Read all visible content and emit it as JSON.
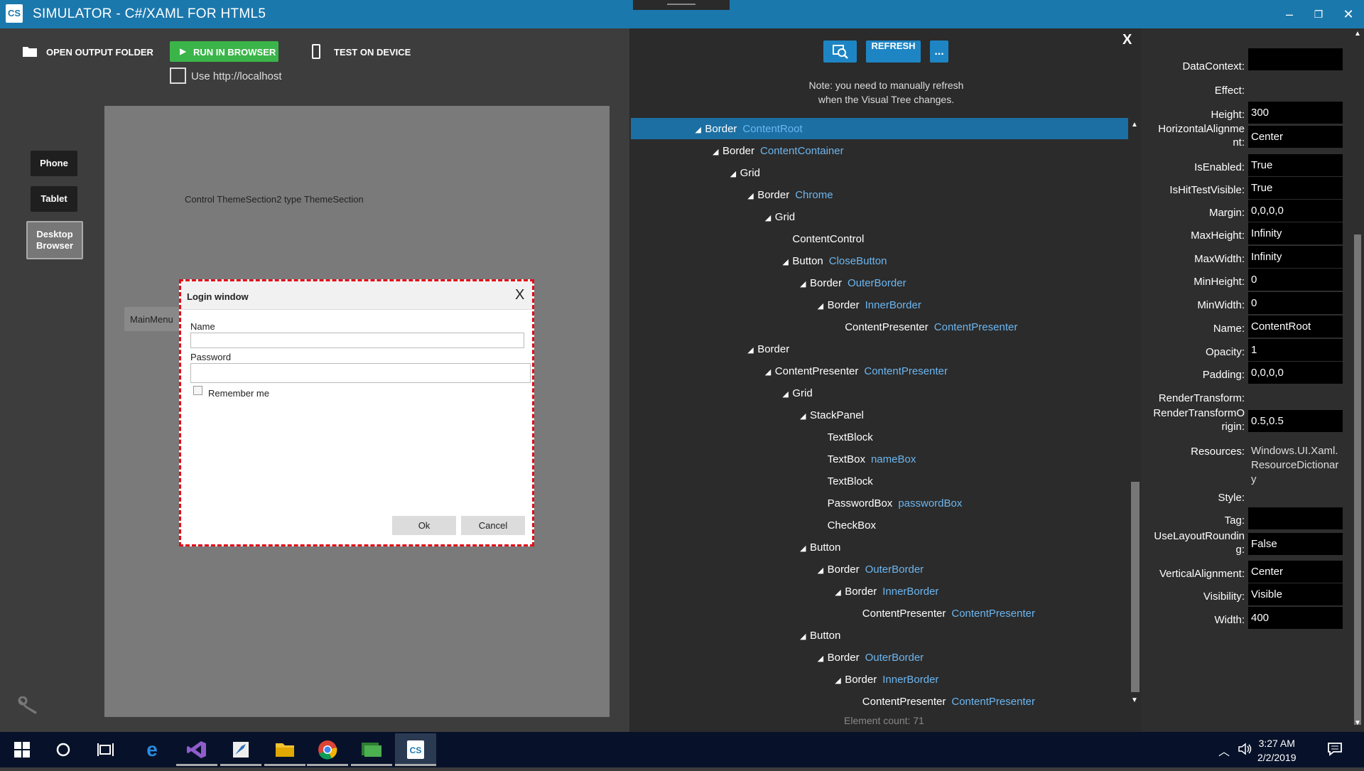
{
  "window": {
    "title": "SIMULATOR - C#/XAML FOR HTML5",
    "logo_text": "CS",
    "controls": [
      "–",
      "❐",
      "✕"
    ]
  },
  "toolbar": {
    "open_output": "OPEN OUTPUT FOLDER",
    "run_browser": "RUN IN BROWSER",
    "test_device": "TEST ON DEVICE",
    "use_localhost": "Use http://localhost"
  },
  "devices": {
    "phone": "Phone",
    "tablet": "Tablet",
    "desktop_line1": "Desktop",
    "desktop_line2": "Browser"
  },
  "preview": {
    "control_text": "Control ThemeSection2 type ThemeSection",
    "mainmenu": "MainMenu"
  },
  "login": {
    "title": "Login window",
    "close": "X",
    "name_label": "Name",
    "password_label": "Password",
    "remember": "Remember me",
    "ok": "Ok",
    "cancel": "Cancel"
  },
  "tree": {
    "refresh": "REFRESH",
    "more": "...",
    "close": "X",
    "note_line1": "Note: you need to manually refresh",
    "note_line2": "when the Visual Tree changes.",
    "element_count": "Element count: 71",
    "rows": [
      {
        "type": "Border",
        "name": "ContentRoot",
        "level": 4,
        "expanded": true,
        "selected": true
      },
      {
        "type": "Border",
        "name": "ContentContainer",
        "level": 5,
        "expanded": true
      },
      {
        "type": "Grid",
        "name": "",
        "level": 6,
        "expanded": true
      },
      {
        "type": "Border",
        "name": "Chrome",
        "level": 7,
        "expanded": true
      },
      {
        "type": "Grid",
        "name": "",
        "level": 8,
        "expanded": true
      },
      {
        "type": "ContentControl",
        "name": "",
        "level": 9,
        "expanded": false
      },
      {
        "type": "Button",
        "name": "CloseButton",
        "level": 9,
        "expanded": true
      },
      {
        "type": "Border",
        "name": "OuterBorder",
        "level": 10,
        "expanded": true
      },
      {
        "type": "Border",
        "name": "InnerBorder",
        "level": 11,
        "expanded": true
      },
      {
        "type": "ContentPresenter",
        "name": "ContentPresenter",
        "level": 12,
        "expanded": false
      },
      {
        "type": "Border",
        "name": "",
        "level": 7,
        "expanded": true
      },
      {
        "type": "ContentPresenter",
        "name": "ContentPresenter",
        "level": 8,
        "expanded": true
      },
      {
        "type": "Grid",
        "name": "",
        "level": 9,
        "expanded": true
      },
      {
        "type": "StackPanel",
        "name": "",
        "level": 10,
        "expanded": true
      },
      {
        "type": "TextBlock",
        "name": "",
        "level": 11,
        "expanded": false
      },
      {
        "type": "TextBox",
        "name": "nameBox",
        "level": 11,
        "expanded": false
      },
      {
        "type": "TextBlock",
        "name": "",
        "level": 11,
        "expanded": false
      },
      {
        "type": "PasswordBox",
        "name": "passwordBox",
        "level": 11,
        "expanded": false
      },
      {
        "type": "CheckBox",
        "name": "",
        "level": 11,
        "expanded": false
      },
      {
        "type": "Button",
        "name": "",
        "level": 10,
        "expanded": true
      },
      {
        "type": "Border",
        "name": "OuterBorder",
        "level": 11,
        "expanded": true
      },
      {
        "type": "Border",
        "name": "InnerBorder",
        "level": 12,
        "expanded": true
      },
      {
        "type": "ContentPresenter",
        "name": "ContentPresenter",
        "level": 13,
        "expanded": false
      },
      {
        "type": "Button",
        "name": "",
        "level": 10,
        "expanded": true
      },
      {
        "type": "Border",
        "name": "OuterBorder",
        "level": 11,
        "expanded": true
      },
      {
        "type": "Border",
        "name": "InnerBorder",
        "level": 12,
        "expanded": true
      },
      {
        "type": "ContentPresenter",
        "name": "ContentPresenter",
        "level": 13,
        "expanded": false
      }
    ]
  },
  "properties": [
    {
      "label": "DataContext:",
      "value": "",
      "kind": "box"
    },
    {
      "label": "Effect:",
      "value": "",
      "kind": "none"
    },
    {
      "label": "Height:",
      "value": "300",
      "kind": "box"
    },
    {
      "label": "HorizontalAlignme\nnt:",
      "value": "Center",
      "kind": "box"
    },
    {
      "label": "IsEnabled:",
      "value": "True",
      "kind": "box"
    },
    {
      "label": "IsHitTestVisible:",
      "value": "True",
      "kind": "box"
    },
    {
      "label": "Margin:",
      "value": "0,0,0,0",
      "kind": "box"
    },
    {
      "label": "MaxHeight:",
      "value": "Infinity",
      "kind": "box"
    },
    {
      "label": "MaxWidth:",
      "value": "Infinity",
      "kind": "box"
    },
    {
      "label": "MinHeight:",
      "value": "0",
      "kind": "box"
    },
    {
      "label": "MinWidth:",
      "value": "0",
      "kind": "box"
    },
    {
      "label": "Name:",
      "value": "ContentRoot",
      "kind": "box"
    },
    {
      "label": "Opacity:",
      "value": "1",
      "kind": "box"
    },
    {
      "label": "Padding:",
      "value": "0,0,0,0",
      "kind": "box"
    },
    {
      "label": "RenderTransform:",
      "value": "",
      "kind": "none"
    },
    {
      "label": "RenderTransformO\nrigin:",
      "value": "0.5,0.5",
      "kind": "box"
    },
    {
      "label": "Resources:",
      "value": "Windows.UI.Xaml.\nResourceDictionar\ny",
      "kind": "plain"
    },
    {
      "label": "Style:",
      "value": "",
      "kind": "none"
    },
    {
      "label": "Tag:",
      "value": "",
      "kind": "box"
    },
    {
      "label": "UseLayoutRoundin\ng:",
      "value": "False",
      "kind": "box"
    },
    {
      "label": "VerticalAlignment:",
      "value": "Center",
      "kind": "box"
    },
    {
      "label": "Visibility:",
      "value": "Visible",
      "kind": "box"
    },
    {
      "label": "Width:",
      "value": "400",
      "kind": "box"
    }
  ],
  "taskbar": {
    "time": "3:27 AM",
    "date": "2/2/2019"
  },
  "colors": {
    "accent": "#1b78ad",
    "run_green": "#3bb54a",
    "tree_selection": "#1b6fa3",
    "tree_name": "#6cb6f0",
    "dialog_border": "#e00d1a"
  }
}
